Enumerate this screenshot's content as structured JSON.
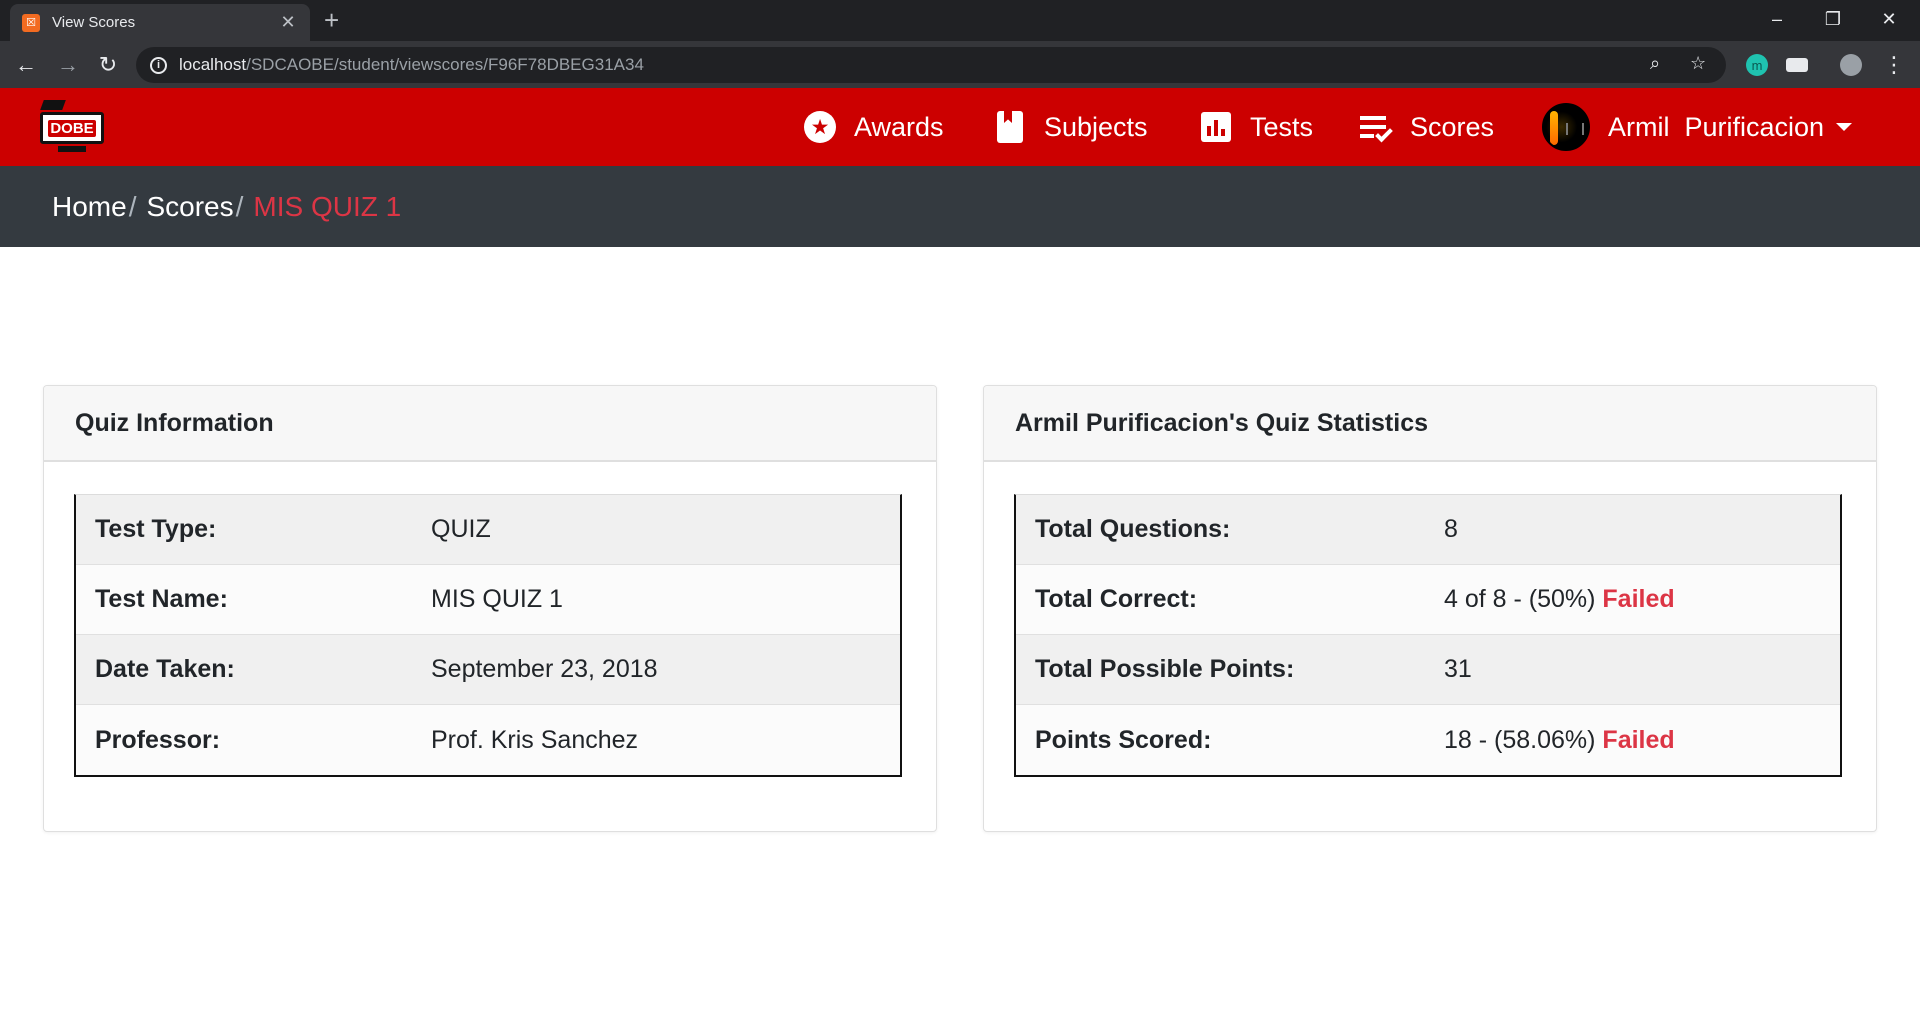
{
  "browser": {
    "tab_title": "View Scores",
    "tab_favicon": "XAMPP",
    "url_host": "localhost",
    "url_path": "/SDCAOBE/student/viewscores/F96F78DBEG31A34",
    "extension_m": "m"
  },
  "app": {
    "logo_text": "DOBE",
    "nav": {
      "awards": "Awards",
      "subjects": "Subjects",
      "tests": "Tests",
      "scores": "Scores",
      "user": "Armil  Purificacion"
    },
    "breadcrumb": {
      "home": "Home",
      "scores": "Scores",
      "current": "MIS QUIZ 1",
      "separator": "/"
    }
  },
  "quiz_info": {
    "title": "Quiz Information",
    "rows": [
      {
        "label": "Test Type:",
        "value": "QUIZ"
      },
      {
        "label": "Test Name:",
        "value": "MIS QUIZ 1"
      },
      {
        "label": "Date Taken:",
        "value": "September 23, 2018"
      },
      {
        "label": "Professor:",
        "value": "Prof. Kris Sanchez"
      }
    ]
  },
  "stats": {
    "title": "Armil Purificacion's Quiz Statistics",
    "rows": [
      {
        "label": "Total Questions:",
        "value": "8",
        "status": ""
      },
      {
        "label": "Total Correct:",
        "value": "4 of 8 - (50%)",
        "status": "Failed"
      },
      {
        "label": "Total Possible Points:",
        "value": "31",
        "status": ""
      },
      {
        "label": "Points Scored:",
        "value": "18 - (58.06%)",
        "status": "Failed"
      }
    ]
  },
  "colors": {
    "navbar": "#cc0000",
    "breadcrumb_bg": "#343a40",
    "failed": "#dc3545"
  }
}
